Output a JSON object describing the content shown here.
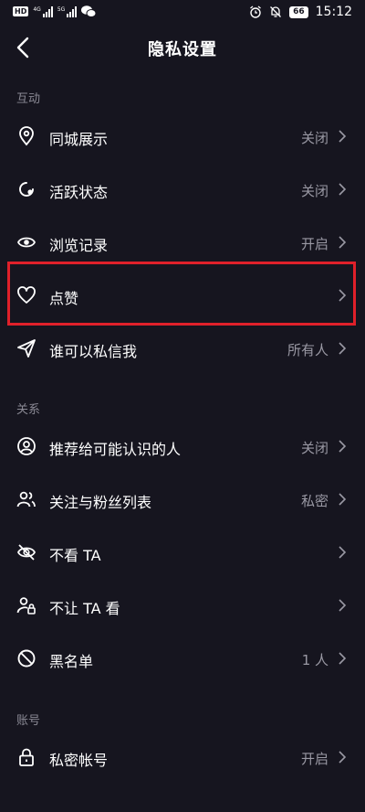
{
  "status_bar": {
    "time": "15:12",
    "battery": "66",
    "left_badge": "HD",
    "network1": "4G",
    "network2": "5G",
    "icons": [
      "signal-icon",
      "wechat-icon",
      "alarm-icon",
      "mute-icon"
    ]
  },
  "header": {
    "title": "隐私设置",
    "back_icon": "back-arrow-icon"
  },
  "sections": {
    "interaction": {
      "label": "互动",
      "items": [
        {
          "label": "同城展示",
          "value": "关闭",
          "icon": "location-pin-icon"
        },
        {
          "label": "活跃状态",
          "value": "关闭",
          "icon": "active-status-icon"
        },
        {
          "label": "浏览记录",
          "value": "开启",
          "icon": "eye-icon"
        },
        {
          "label": "点赞",
          "value": "",
          "icon": "heart-icon"
        },
        {
          "label": "谁可以私信我",
          "value": "所有人",
          "icon": "send-icon"
        }
      ]
    },
    "relationship": {
      "label": "关系",
      "items": [
        {
          "label": "推荐给可能认识的人",
          "value": "关闭",
          "icon": "user-circle-icon"
        },
        {
          "label": "关注与粉丝列表",
          "value": "私密",
          "icon": "users-icon"
        },
        {
          "label": "不看 TA",
          "value": "",
          "icon": "eye-off-icon"
        },
        {
          "label": "不让 TA 看",
          "value": "",
          "icon": "user-lock-icon"
        },
        {
          "label": "黑名单",
          "value": "1 人",
          "icon": "block-icon"
        }
      ]
    },
    "account": {
      "label": "账号",
      "items": [
        {
          "label": "私密帐号",
          "value": "开启",
          "icon": "lock-icon"
        }
      ]
    }
  },
  "colors": {
    "background": "#16151f",
    "highlight": "#e0202a",
    "muted": "#9a99a4"
  }
}
